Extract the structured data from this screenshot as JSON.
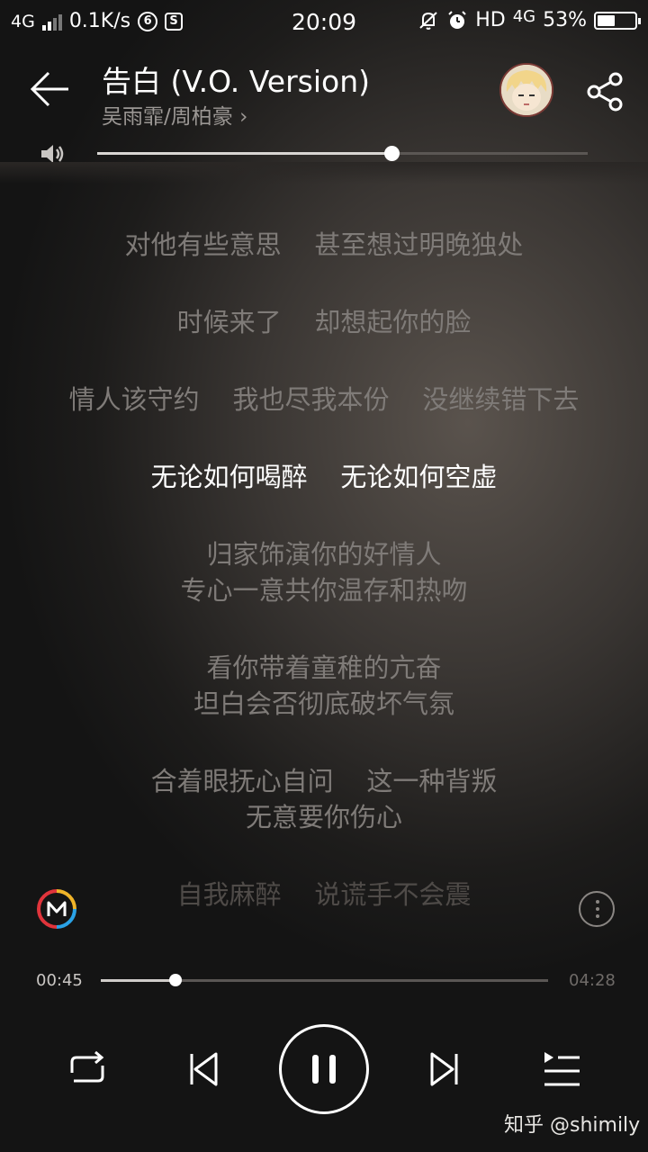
{
  "status_bar": {
    "network": "4G",
    "speed": "0.1K/s",
    "time": "20:09",
    "hd_label": "HD",
    "network_right": "4G",
    "battery_percent": "53%",
    "battery_level": 0.53,
    "icons": [
      "signal-icon",
      "app-notify-icon",
      "s-badge-icon",
      "mute-alert-icon",
      "alarm-icon",
      "battery-icon"
    ]
  },
  "header": {
    "title": "告白 (V.O. Version)",
    "artist": "吴雨霏/周柏豪",
    "artist_chevron": "›"
  },
  "volume": {
    "level": 0.6
  },
  "lyrics": [
    {
      "text": "对他有些意思    甚至想过明晚独处",
      "state": "normal"
    },
    {
      "text": "时候来了    却想起你的脸",
      "state": "normal"
    },
    {
      "text": "情人该守约    我也尽我本份    没继续错下去",
      "state": "normal"
    },
    {
      "text": "无论如何喝醉    无论如何空虚",
      "state": "current"
    },
    {
      "text": "归家饰演你的好情人",
      "state": "normal"
    },
    {
      "text": "专心一意共你温存和热吻",
      "state": "normal"
    },
    {
      "text": "看你带着童稚的亢奋",
      "state": "normal"
    },
    {
      "text": "坦白会否彻底破坏气氛",
      "state": "normal"
    },
    {
      "text": "合着眼抚心自问    这一种背叛",
      "state": "normal"
    },
    {
      "text": "无意要你伤心",
      "state": "normal"
    },
    {
      "text": "自我麻醉    说谎手不会震",
      "state": "faded"
    }
  ],
  "playback": {
    "current_time": "00:45",
    "total_time": "04:28",
    "progress": 0.168
  },
  "watermark": "知乎 @shimily",
  "colors": {
    "accent_red": "#e0343b",
    "accent_blue": "#2aa2e6",
    "accent_yellow": "#f0b429"
  }
}
